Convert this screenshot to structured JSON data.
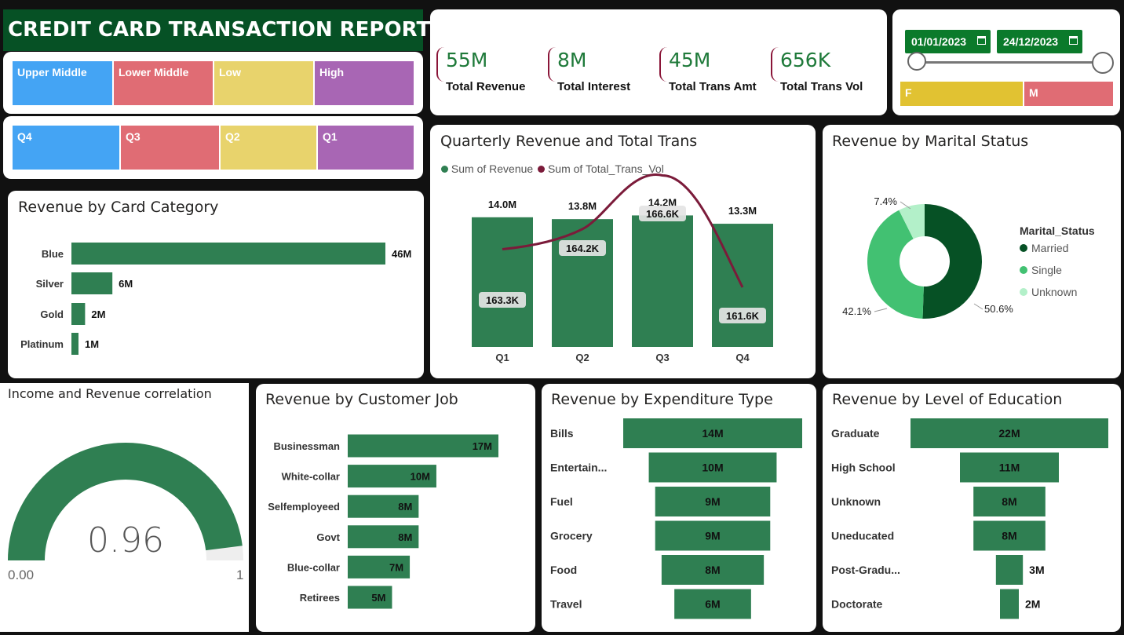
{
  "header": {
    "title": "CREDIT CARD TRANSACTION REPORT"
  },
  "income_slicer": [
    "Upper Middle",
    "Lower Middle",
    "Low",
    "High"
  ],
  "quarter_slicer": [
    "Q4",
    "Q3",
    "Q2",
    "Q1"
  ],
  "gender_slicer": [
    "F",
    "M"
  ],
  "date_range": {
    "start": "01/01/2023",
    "end": "24/12/2023"
  },
  "kpis": [
    {
      "value": "55M",
      "label": "Total Revenue"
    },
    {
      "value": "8M",
      "label": "Total Interest"
    },
    {
      "value": "45M",
      "label": "Total Trans Amt"
    },
    {
      "value": "656K",
      "label": "Total Trans Vol"
    }
  ],
  "colors": {
    "green": "#2f7f52",
    "dark_green": "#065125",
    "wine": "#7b1b3a",
    "blue": "#44a4f4",
    "red": "#e06c74",
    "yellow": "#e8d36c",
    "purple": "#a866b4",
    "gold": "#e1c232"
  },
  "card_category": {
    "title": "Revenue by Card Category",
    "chart_data": {
      "type": "bar",
      "orientation": "horizontal",
      "categories": [
        "Blue",
        "Silver",
        "Gold",
        "Platinum"
      ],
      "values": [
        46,
        6,
        2,
        1
      ],
      "labels": [
        "46M",
        "6M",
        "2M",
        "1M"
      ]
    }
  },
  "quarterly": {
    "title": "Quarterly Revenue and Total Trans",
    "chart_data": {
      "type": "bar",
      "categories": [
        "Q1",
        "Q2",
        "Q3",
        "Q4"
      ],
      "series": [
        {
          "name": "Sum of Revenue",
          "values": [
            14.0,
            13.8,
            14.2,
            13.3
          ],
          "labels": [
            "14.0M",
            "13.8M",
            "14.2M",
            "13.3M"
          ]
        },
        {
          "name": "Sum of Total_Trans_Vol",
          "values": [
            163.3,
            164.2,
            166.6,
            161.6
          ],
          "labels": [
            "163.3K",
            "164.2K",
            "166.6K",
            "161.6K"
          ]
        }
      ]
    }
  },
  "marital": {
    "title": "Revenue by Marital Status",
    "legend_title": "Marital_Status",
    "chart_data": {
      "type": "pie",
      "categories": [
        "Married",
        "Single",
        "Unknown"
      ],
      "values": [
        50.6,
        42.1,
        7.4
      ],
      "labels": [
        "50.6%",
        "42.1%",
        "7.4%"
      ],
      "colors": [
        "#065125",
        "#42c172",
        "#b3f0c9"
      ]
    }
  },
  "gauge": {
    "title": "Income and Revenue correlation",
    "value": "0.96",
    "min": "0.00",
    "max": "1",
    "fill_fraction": 0.96
  },
  "customer_job": {
    "title": "Revenue by Customer Job",
    "chart_data": {
      "type": "bar",
      "orientation": "horizontal",
      "categories": [
        "Businessman",
        "White-collar",
        "Selfemployeed",
        "Govt",
        "Blue-collar",
        "Retirees"
      ],
      "values": [
        17,
        10,
        8,
        8,
        7,
        5
      ],
      "labels": [
        "17M",
        "10M",
        "8M",
        "8M",
        "7M",
        "5M"
      ]
    }
  },
  "expenditure": {
    "title": "Revenue by Expenditure Type",
    "chart_data": {
      "type": "bar",
      "orientation": "funnel",
      "categories": [
        "Bills",
        "Entertain...",
        "Fuel",
        "Grocery",
        "Food",
        "Travel"
      ],
      "values": [
        14,
        10,
        9,
        9,
        8,
        6
      ],
      "labels": [
        "14M",
        "10M",
        "9M",
        "9M",
        "8M",
        "6M"
      ]
    }
  },
  "education": {
    "title": "Revenue by Level of Education",
    "chart_data": {
      "type": "bar",
      "orientation": "funnel",
      "categories": [
        "Graduate",
        "High School",
        "Unknown",
        "Uneducated",
        "Post-Gradu...",
        "Doctorate"
      ],
      "values": [
        22,
        11,
        8,
        8,
        3,
        2
      ],
      "labels": [
        "22M",
        "11M",
        "8M",
        "8M",
        "3M",
        "2M"
      ]
    }
  }
}
